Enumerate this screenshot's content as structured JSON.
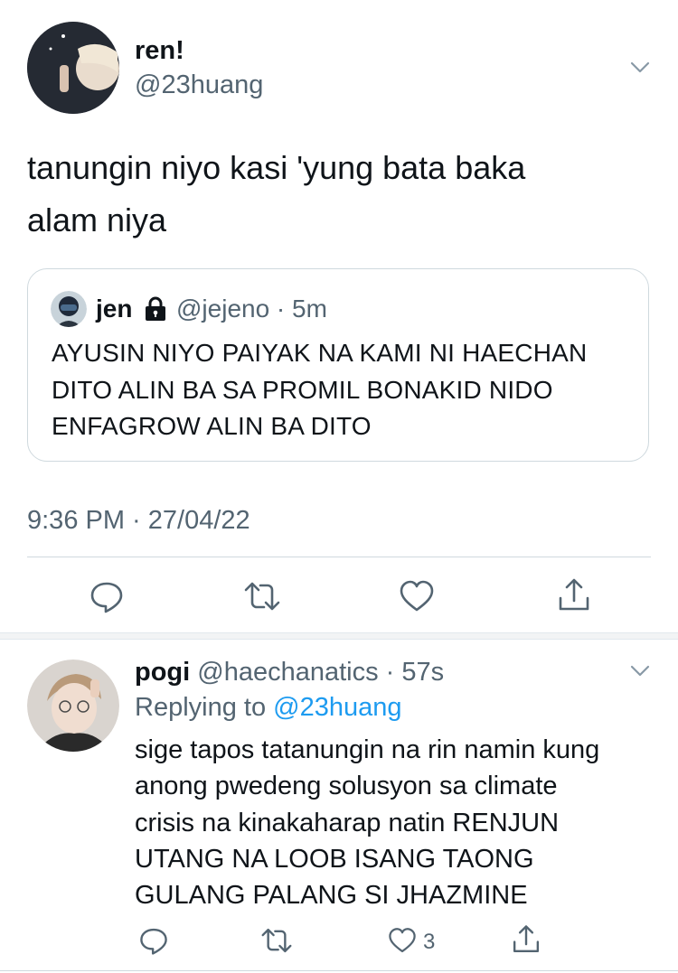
{
  "main_tweet": {
    "author_name": "ren!",
    "author_handle": "@23huang",
    "text_line1": "tanungin niyo kasi 'yung bata baka",
    "text_line2": "alam niya",
    "timestamp": "9:36 PM · 27/04/22",
    "icons": [
      "chevron-down-icon",
      "reply-icon",
      "retweet-icon",
      "like-icon",
      "share-icon"
    ]
  },
  "quoted_tweet": {
    "author_name": "jen",
    "author_handle": "@jejeno",
    "time_ago": "5m",
    "line1": "AYUSIN NIYO PAIYAK NA KAMI NI HAECHAN",
    "line2": "DITO ALIN BA SA PROMIL BONAKID NIDO",
    "line3": "ENFAGROW ALIN BA DITO",
    "icons": [
      "lock-icon"
    ]
  },
  "reply_tweet": {
    "author_name": "pogi",
    "author_handle": "@haechanatics",
    "time_ago": "57s",
    "replying_to_label": "Replying to",
    "replying_to_handle": "@23huang",
    "line1": "sige tapos tatanungin na rin namin kung",
    "line2": "anong pwedeng solusyon sa climate",
    "line3": "crisis na kinakaharap natin RENJUN",
    "line4": "UTANG NA LOOB ISANG TAONG",
    "line5": "GULANG PALANG SI JHAZMINE",
    "like_count": "3"
  },
  "colors": {
    "text": "#0f1419",
    "muted": "#536471",
    "link": "#1d9bf0",
    "divider": "#cfd9de"
  }
}
